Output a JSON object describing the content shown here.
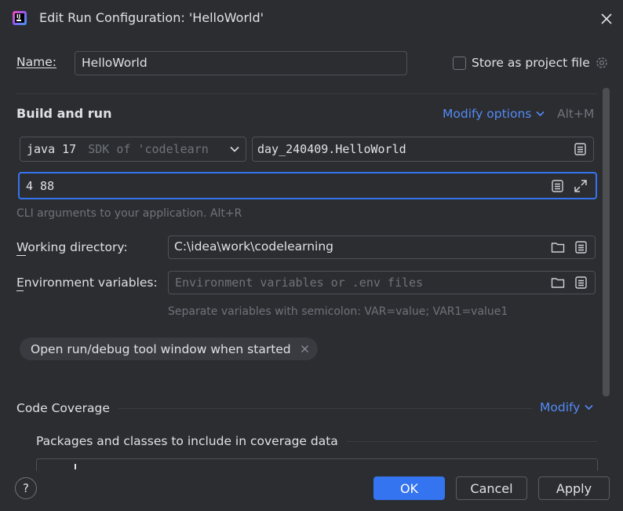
{
  "window": {
    "title": "Edit Run Configuration: 'HelloWorld'"
  },
  "name_row": {
    "label": "Name:",
    "value": "HelloWorld",
    "store_label": "Store as project file",
    "store_checked": false
  },
  "build_run": {
    "title": "Build and run",
    "modify_options": "Modify options",
    "shortcut": "Alt+M",
    "jdk_main": "java 17",
    "jdk_sub": "SDK of 'codelearn",
    "main_class": "day_240409.HelloWorld",
    "program_args": "4 88",
    "args_hint": "CLI arguments to your application. Alt+R"
  },
  "working_dir": {
    "label": "Working directory:",
    "value": "C:\\idea\\work\\codelearning"
  },
  "env_vars": {
    "label": "Environment variables:",
    "placeholder": "Environment variables or .env files",
    "hint": "Separate variables with semicolon: VAR=value; VAR1=value1"
  },
  "chip": {
    "label": "Open run/debug tool window when started"
  },
  "coverage": {
    "title": "Code Coverage",
    "modify": "Modify",
    "packages_label": "Packages and classes to include in coverage data"
  },
  "footer": {
    "help": "?",
    "ok": "OK",
    "cancel": "Cancel",
    "apply": "Apply"
  },
  "colors": {
    "background": "#2b2d30",
    "accent": "#3574f0",
    "link": "#548af7",
    "focus": "#3574f0"
  }
}
